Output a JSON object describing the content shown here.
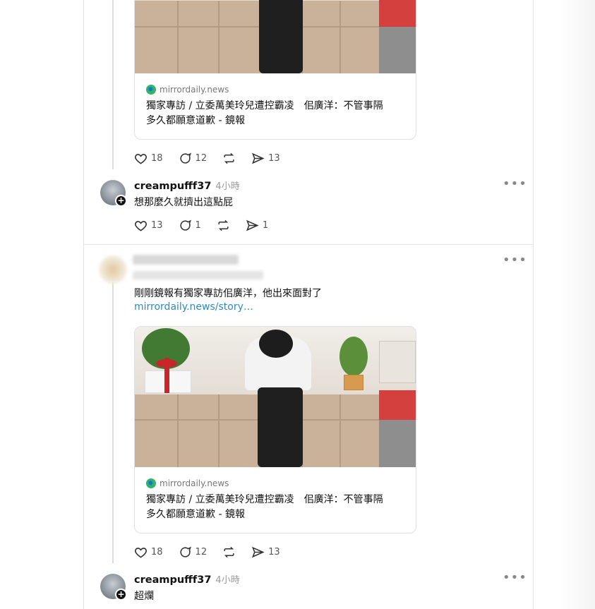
{
  "posts": [
    {
      "card": {
        "source": "mirrordaily.news",
        "headline": "獨家專訪 / 立委萬美玲兒遭控霸凌　佀廣洋：不管事隔\n多久都願意道歉 - 鏡報"
      },
      "actions": {
        "likes": "18",
        "replies": "12",
        "shares": "13"
      }
    },
    {
      "reply": {
        "username": "creampufff37",
        "time": "4小時",
        "text": "想那麼久就擠出這點屁",
        "actions": {
          "likes": "13",
          "replies": "1",
          "shares": "1"
        }
      }
    },
    {
      "text": "剛剛鏡報有獨家專訪佀廣洋，他出來面對了",
      "link": "mirrordaily.news/story…",
      "card": {
        "source": "mirrordaily.news",
        "headline": "獨家專訪 / 立委萬美玲兒遭控霸凌　佀廣洋：不管事隔\n多久都願意道歉 - 鏡報"
      },
      "actions": {
        "likes": "18",
        "replies": "12",
        "shares": "13"
      }
    },
    {
      "reply": {
        "username": "creampufff37",
        "time": "4小時",
        "text": "超爛"
      }
    }
  ],
  "icons": [
    "heart-icon",
    "reply-icon",
    "repost-icon",
    "share-icon",
    "more-icon",
    "follow-plus-icon"
  ],
  "colors": {
    "link": "#2e8bc0",
    "muted": "#999999"
  }
}
